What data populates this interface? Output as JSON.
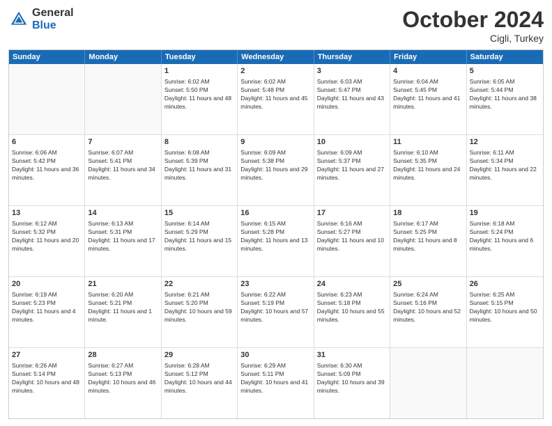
{
  "header": {
    "logo_general": "General",
    "logo_blue": "Blue",
    "month_title": "October 2024",
    "location": "Cigli, Turkey"
  },
  "days_of_week": [
    "Sunday",
    "Monday",
    "Tuesday",
    "Wednesday",
    "Thursday",
    "Friday",
    "Saturday"
  ],
  "weeks": [
    [
      {
        "day": "",
        "sunrise": "",
        "sunset": "",
        "daylight": "",
        "empty": true
      },
      {
        "day": "",
        "sunrise": "",
        "sunset": "",
        "daylight": "",
        "empty": true
      },
      {
        "day": "1",
        "sunrise": "Sunrise: 6:02 AM",
        "sunset": "Sunset: 5:50 PM",
        "daylight": "Daylight: 11 hours and 48 minutes.",
        "empty": false
      },
      {
        "day": "2",
        "sunrise": "Sunrise: 6:02 AM",
        "sunset": "Sunset: 5:48 PM",
        "daylight": "Daylight: 11 hours and 45 minutes.",
        "empty": false
      },
      {
        "day": "3",
        "sunrise": "Sunrise: 6:03 AM",
        "sunset": "Sunset: 5:47 PM",
        "daylight": "Daylight: 11 hours and 43 minutes.",
        "empty": false
      },
      {
        "day": "4",
        "sunrise": "Sunrise: 6:04 AM",
        "sunset": "Sunset: 5:45 PM",
        "daylight": "Daylight: 11 hours and 41 minutes.",
        "empty": false
      },
      {
        "day": "5",
        "sunrise": "Sunrise: 6:05 AM",
        "sunset": "Sunset: 5:44 PM",
        "daylight": "Daylight: 11 hours and 38 minutes.",
        "empty": false
      }
    ],
    [
      {
        "day": "6",
        "sunrise": "Sunrise: 6:06 AM",
        "sunset": "Sunset: 5:42 PM",
        "daylight": "Daylight: 11 hours and 36 minutes.",
        "empty": false
      },
      {
        "day": "7",
        "sunrise": "Sunrise: 6:07 AM",
        "sunset": "Sunset: 5:41 PM",
        "daylight": "Daylight: 11 hours and 34 minutes.",
        "empty": false
      },
      {
        "day": "8",
        "sunrise": "Sunrise: 6:08 AM",
        "sunset": "Sunset: 5:39 PM",
        "daylight": "Daylight: 11 hours and 31 minutes.",
        "empty": false
      },
      {
        "day": "9",
        "sunrise": "Sunrise: 6:09 AM",
        "sunset": "Sunset: 5:38 PM",
        "daylight": "Daylight: 11 hours and 29 minutes.",
        "empty": false
      },
      {
        "day": "10",
        "sunrise": "Sunrise: 6:09 AM",
        "sunset": "Sunset: 5:37 PM",
        "daylight": "Daylight: 11 hours and 27 minutes.",
        "empty": false
      },
      {
        "day": "11",
        "sunrise": "Sunrise: 6:10 AM",
        "sunset": "Sunset: 5:35 PM",
        "daylight": "Daylight: 11 hours and 24 minutes.",
        "empty": false
      },
      {
        "day": "12",
        "sunrise": "Sunrise: 6:11 AM",
        "sunset": "Sunset: 5:34 PM",
        "daylight": "Daylight: 11 hours and 22 minutes.",
        "empty": false
      }
    ],
    [
      {
        "day": "13",
        "sunrise": "Sunrise: 6:12 AM",
        "sunset": "Sunset: 5:32 PM",
        "daylight": "Daylight: 11 hours and 20 minutes.",
        "empty": false
      },
      {
        "day": "14",
        "sunrise": "Sunrise: 6:13 AM",
        "sunset": "Sunset: 5:31 PM",
        "daylight": "Daylight: 11 hours and 17 minutes.",
        "empty": false
      },
      {
        "day": "15",
        "sunrise": "Sunrise: 6:14 AM",
        "sunset": "Sunset: 5:29 PM",
        "daylight": "Daylight: 11 hours and 15 minutes.",
        "empty": false
      },
      {
        "day": "16",
        "sunrise": "Sunrise: 6:15 AM",
        "sunset": "Sunset: 5:28 PM",
        "daylight": "Daylight: 11 hours and 13 minutes.",
        "empty": false
      },
      {
        "day": "17",
        "sunrise": "Sunrise: 6:16 AM",
        "sunset": "Sunset: 5:27 PM",
        "daylight": "Daylight: 11 hours and 10 minutes.",
        "empty": false
      },
      {
        "day": "18",
        "sunrise": "Sunrise: 6:17 AM",
        "sunset": "Sunset: 5:25 PM",
        "daylight": "Daylight: 11 hours and 8 minutes.",
        "empty": false
      },
      {
        "day": "19",
        "sunrise": "Sunrise: 6:18 AM",
        "sunset": "Sunset: 5:24 PM",
        "daylight": "Daylight: 11 hours and 6 minutes.",
        "empty": false
      }
    ],
    [
      {
        "day": "20",
        "sunrise": "Sunrise: 6:19 AM",
        "sunset": "Sunset: 5:23 PM",
        "daylight": "Daylight: 11 hours and 4 minutes.",
        "empty": false
      },
      {
        "day": "21",
        "sunrise": "Sunrise: 6:20 AM",
        "sunset": "Sunset: 5:21 PM",
        "daylight": "Daylight: 11 hours and 1 minute.",
        "empty": false
      },
      {
        "day": "22",
        "sunrise": "Sunrise: 6:21 AM",
        "sunset": "Sunset: 5:20 PM",
        "daylight": "Daylight: 10 hours and 59 minutes.",
        "empty": false
      },
      {
        "day": "23",
        "sunrise": "Sunrise: 6:22 AM",
        "sunset": "Sunset: 5:19 PM",
        "daylight": "Daylight: 10 hours and 57 minutes.",
        "empty": false
      },
      {
        "day": "24",
        "sunrise": "Sunrise: 6:23 AM",
        "sunset": "Sunset: 5:18 PM",
        "daylight": "Daylight: 10 hours and 55 minutes.",
        "empty": false
      },
      {
        "day": "25",
        "sunrise": "Sunrise: 6:24 AM",
        "sunset": "Sunset: 5:16 PM",
        "daylight": "Daylight: 10 hours and 52 minutes.",
        "empty": false
      },
      {
        "day": "26",
        "sunrise": "Sunrise: 6:25 AM",
        "sunset": "Sunset: 5:15 PM",
        "daylight": "Daylight: 10 hours and 50 minutes.",
        "empty": false
      }
    ],
    [
      {
        "day": "27",
        "sunrise": "Sunrise: 6:26 AM",
        "sunset": "Sunset: 5:14 PM",
        "daylight": "Daylight: 10 hours and 48 minutes.",
        "empty": false
      },
      {
        "day": "28",
        "sunrise": "Sunrise: 6:27 AM",
        "sunset": "Sunset: 5:13 PM",
        "daylight": "Daylight: 10 hours and 46 minutes.",
        "empty": false
      },
      {
        "day": "29",
        "sunrise": "Sunrise: 6:28 AM",
        "sunset": "Sunset: 5:12 PM",
        "daylight": "Daylight: 10 hours and 44 minutes.",
        "empty": false
      },
      {
        "day": "30",
        "sunrise": "Sunrise: 6:29 AM",
        "sunset": "Sunset: 5:11 PM",
        "daylight": "Daylight: 10 hours and 41 minutes.",
        "empty": false
      },
      {
        "day": "31",
        "sunrise": "Sunrise: 6:30 AM",
        "sunset": "Sunset: 5:09 PM",
        "daylight": "Daylight: 10 hours and 39 minutes.",
        "empty": false
      },
      {
        "day": "",
        "sunrise": "",
        "sunset": "",
        "daylight": "",
        "empty": true
      },
      {
        "day": "",
        "sunrise": "",
        "sunset": "",
        "daylight": "",
        "empty": true
      }
    ]
  ]
}
